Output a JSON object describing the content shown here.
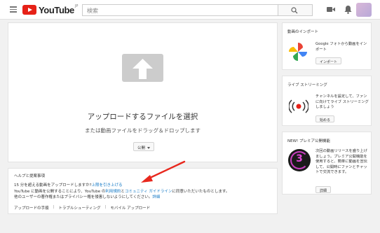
{
  "header": {
    "logo_text": "YouTube",
    "logo_region": "JP",
    "search_placeholder": "検索"
  },
  "upload": {
    "title": "アップロードするファイルを選択",
    "subtitle": "または動画ファイルをドラッグ＆ドロップします",
    "privacy_value": "公開"
  },
  "help": {
    "title": "ヘルプと提案事項",
    "line1_prefix": "15 分を超える動画をアップロードしますか?",
    "line1_link": "上限を引き上げる",
    "line2_prefix": "YouTube に動画を公開することにより、YouTube の",
    "line2_link1": "利用規約",
    "line2_mid": "と",
    "line2_link2": "コミュニティ ガイドライン",
    "line2_suffix": "に同意いただいたものとします。",
    "line3_prefix": "他のユーザーの著作権またはプライバシー権を侵害しないようにしてください。",
    "line3_link": "詳細",
    "links": [
      "アップロードの手順",
      "トラブルシューティング",
      "モバイル アップロード"
    ]
  },
  "sidebar": {
    "import": {
      "title": "動画のインポート",
      "text": "Google フォトから動画をインポート",
      "button": "インポート"
    },
    "live": {
      "title": "ライブ ストリーミング",
      "text": "チャンネルを設定して、ファンに向けてライブ ストリーミングしましょう",
      "button": "始める"
    },
    "premiere": {
      "title": "NEW! プレミア公開機能",
      "text": "次回の動画リリースを盛り上げましょう。プレミア公開機能を使用すると、簡単に動画を宣伝して、公開時にファンとチャットで交流できます。",
      "button": "詳細",
      "countdown": "3"
    }
  },
  "colors": {
    "brand_red": "#e62117",
    "link_blue": "#167ac6",
    "annotation_arrow": "#e8281e"
  }
}
